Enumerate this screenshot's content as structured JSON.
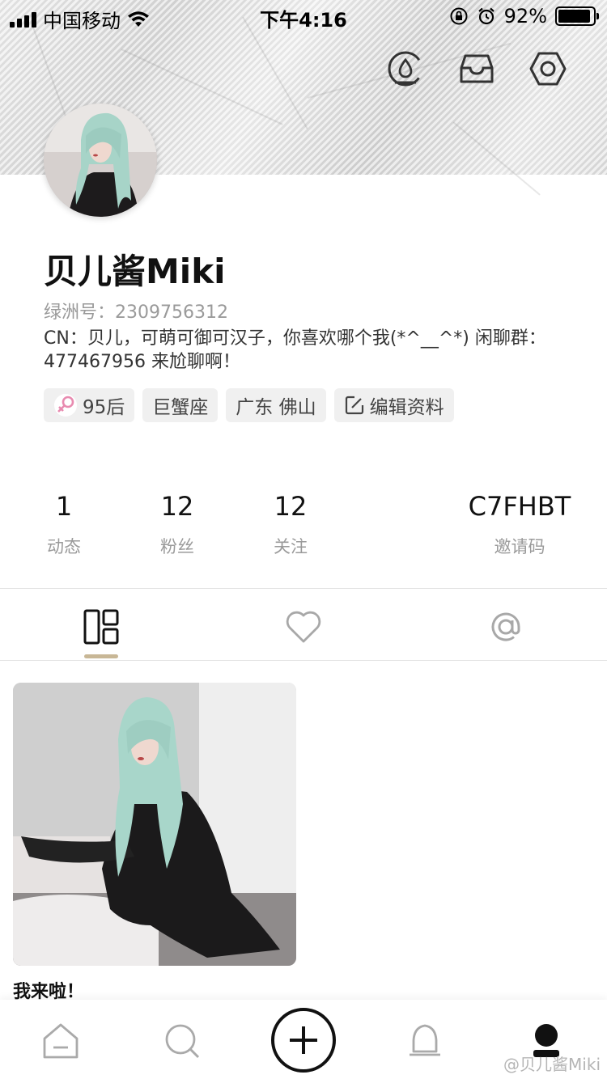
{
  "status_bar": {
    "carrier": "中国移动",
    "time": "下午4:16",
    "battery_percent": "92%",
    "battery_level": 0.92
  },
  "header": {
    "icons": [
      "water-drop-icon",
      "inbox-icon",
      "settings-hexagon-icon"
    ]
  },
  "profile": {
    "username": "贝儿酱Miki",
    "oasis_id": "绿洲号：2309756312",
    "bio": "CN：贝儿，可萌可御可汉子，你喜欢哪个我(*^__^*) 闲聊群：477467956 来尬聊啊！",
    "tags": {
      "age": "95后",
      "zodiac": "巨蟹座",
      "location": "广东 佛山",
      "edit": "编辑资料"
    },
    "accent_color": "#c8b796",
    "female_icon_color": "#e88bb0"
  },
  "stats": {
    "posts": {
      "value": "1",
      "label": "动态"
    },
    "fans": {
      "value": "12",
      "label": "粉丝"
    },
    "following": {
      "value": "12",
      "label": "关注"
    },
    "invite_code": {
      "value": "C7FHBT",
      "label": "邀请码"
    }
  },
  "tabs": [
    "grid-layout-icon",
    "heart-icon",
    "at-icon"
  ],
  "posts": [
    {
      "caption": "我来啦！"
    }
  ],
  "bottom_nav": [
    "home-icon",
    "search-icon",
    "add-icon",
    "bell-icon",
    "profile-icon"
  ],
  "watermark": "@贝儿酱Miki"
}
